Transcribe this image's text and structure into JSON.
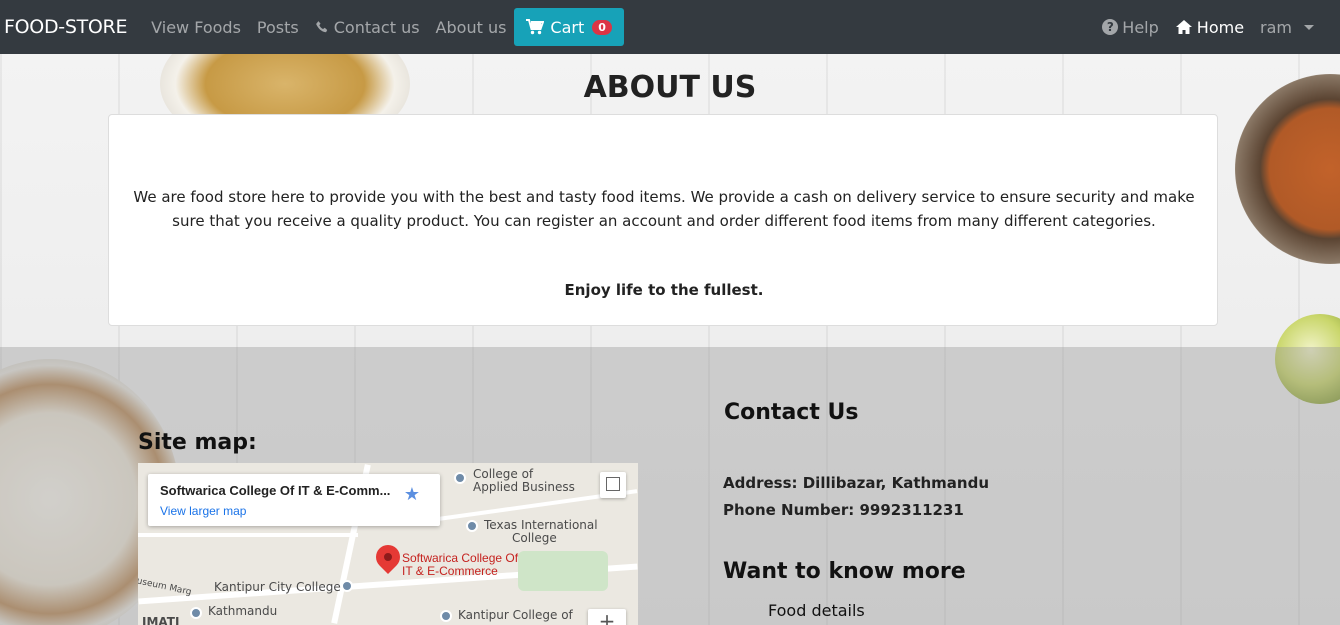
{
  "navbar": {
    "brand": "FOOD-STORE",
    "links": [
      "View Foods",
      "Posts",
      "Contact us",
      "About us"
    ],
    "cart_label": "Cart",
    "cart_count": "0",
    "help_label": "Help",
    "home_label": "Home",
    "user_label": "ram"
  },
  "about": {
    "title": "ABOUT US",
    "body": "We are food store here to provide you with the best and tasty food items. We provide a cash on delivery service to ensure security and make sure that you receive a quality product. You can register an account and order different food items from many different categories.",
    "tagline": "Enjoy life to the fullest."
  },
  "footer": {
    "sitemap_title": "Site map:",
    "map": {
      "place_name": "Softwarica College Of IT & E-Comm...",
      "view_larger": "View larger map",
      "pin_label_1": "Softwarica College Of",
      "pin_label_2": "IT & E-Commerce",
      "labels": {
        "college_applied_1": "College of",
        "college_applied_2": "Applied Business",
        "texas_1": "Texas International",
        "texas_2": "College",
        "kantipur_city": "Kantipur City College",
        "kathmandu_eng": "Kathmandu",
        "kantipur_college": "Kantipur College of",
        "museum": "useum Marg",
        "imati": "IMATI"
      },
      "zoom_in": "+"
    },
    "contact_title": "Contact Us",
    "address": "Address: Dillibazar, Kathmandu",
    "phone": "Phone Number: 9992311231",
    "more_title": "Want to know more",
    "more_link": "Food details"
  },
  "colors": {
    "navbar_bg": "#343a40",
    "cart_bg": "#17a2b8",
    "badge_bg": "#dc3545",
    "map_pin": "#e53935",
    "link_blue": "#1a73e8"
  },
  "icons": [
    "shopping-cart-icon",
    "phone-icon",
    "question-circle-icon",
    "home-icon",
    "caret-down-icon",
    "star-icon",
    "map-pin-icon",
    "fullscreen-icon"
  ]
}
